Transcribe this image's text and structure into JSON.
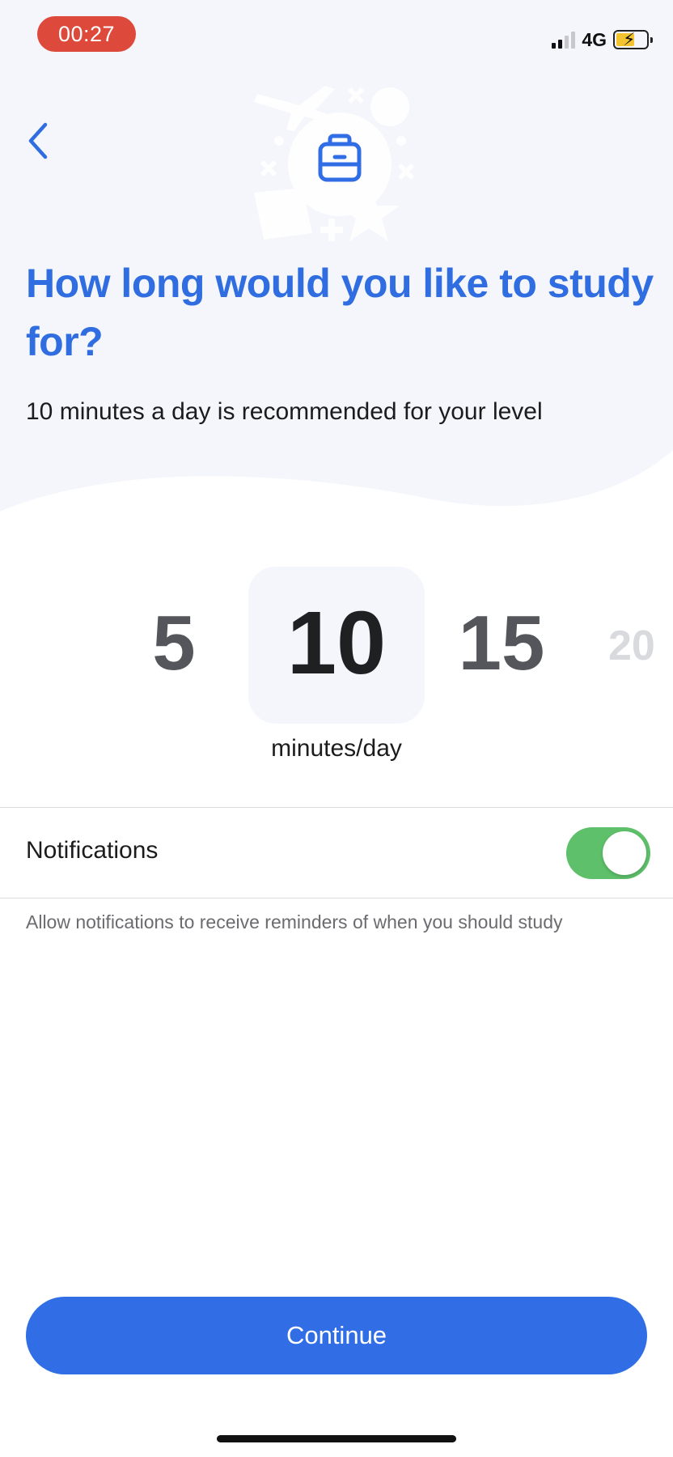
{
  "status_bar": {
    "timer": "00:27",
    "network": "4G"
  },
  "header": {
    "back_icon": "chevron-left-icon",
    "illustration_icon": "briefcase-icon",
    "title": "How long would you like to study for?",
    "subtitle": "10 minutes a day is recommended for your level"
  },
  "picker": {
    "options": [
      "5",
      "10",
      "15",
      "20"
    ],
    "selected": "10",
    "unit_label": "minutes/day"
  },
  "notifications": {
    "label": "Notifications",
    "enabled": true,
    "help_text": "Allow notifications to receive reminders of when you should study"
  },
  "footer": {
    "continue_label": "Continue"
  },
  "colors": {
    "accent": "#316ee6",
    "title": "#2f6de0",
    "toggle_on": "#5ec06a",
    "timer_pill": "#dd4a3c",
    "hero_background": "#f4f6fb"
  }
}
